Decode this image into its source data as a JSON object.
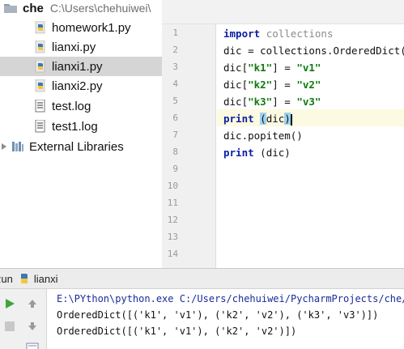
{
  "project": {
    "root_name": "che",
    "root_path": "C:\\Users\\chehuiwei\\",
    "files": [
      {
        "name": "homework1.py",
        "type": "python"
      },
      {
        "name": "lianxi.py",
        "type": "python"
      },
      {
        "name": "lianxi1.py",
        "type": "python",
        "selected": true
      },
      {
        "name": "lianxi2.py",
        "type": "python"
      },
      {
        "name": "test.log",
        "type": "log"
      },
      {
        "name": "test1.log",
        "type": "log"
      }
    ],
    "external_libraries": "External Libraries"
  },
  "editor": {
    "line_numbers": [
      "1",
      "2",
      "3",
      "4",
      "5",
      "6",
      "7",
      "8",
      "9",
      "10",
      "11",
      "12",
      "13",
      "14"
    ],
    "code": {
      "l1_kw": "import",
      "l1_rest": "collections",
      "l2": "dic = collections.OrderedDict()",
      "l3_pre": "dic[",
      "l3_key": "\"k1\"",
      "l3_mid": "] = ",
      "l3_val": "\"v1\"",
      "l4_pre": "dic[",
      "l4_key": "\"k2\"",
      "l4_mid": "] = ",
      "l4_val": "\"v2\"",
      "l5_pre": "dic[",
      "l5_key": "\"k3\"",
      "l5_mid": "] = ",
      "l5_val": "\"v3\"",
      "l6_kw": "print",
      "l6_open": "(",
      "l6_arg": "dic",
      "l6_close": ")",
      "l7": "dic.popitem()",
      "l8_kw": "print",
      "l8_rest": "(dic)"
    }
  },
  "run": {
    "label": "Run",
    "tab_name": "lianxi",
    "console": [
      "E:\\PYthon\\python.exe C:/Users/chehuiwei/PycharmProjects/che/lianxi",
      "OrderedDict([('k1', 'v1'), ('k2', 'v2'), ('k3', 'v3')])",
      "OrderedDict([('k1', 'v1'), ('k2', 'v2')])"
    ]
  },
  "icons": {
    "python_file": "python-file-icon",
    "log_file": "log-file-icon",
    "folder": "folder-icon",
    "run": "run-icon",
    "stop": "stop-icon",
    "up": "up-arrow-icon",
    "down": "down-arrow-icon"
  },
  "colors": {
    "keyword": "#0a1ea3",
    "string": "#0b7a0b",
    "selected_row": "#d5d5d5",
    "caret_line": "#fcfae0",
    "console_command": "#1a2b9c",
    "run_green": "#3fa53a"
  }
}
